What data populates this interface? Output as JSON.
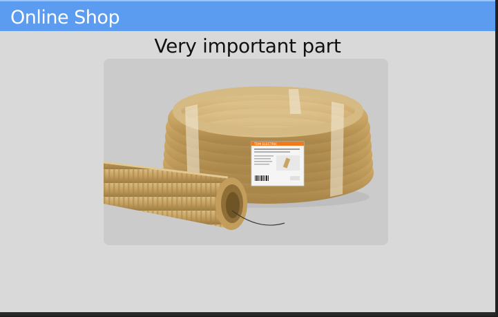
{
  "window": {
    "title": "Online Shop"
  },
  "product": {
    "heading": "Very important part",
    "image_label": "corrugated-conduit-coil",
    "package_brand": "TDM ELECTRIC"
  },
  "colors": {
    "titlebar": "#5b9bf0",
    "window_bg": "#d9d9d9",
    "card_bg": "#cbcbcb",
    "pipe": "#c9a463",
    "label_accent": "#f07a1c"
  }
}
